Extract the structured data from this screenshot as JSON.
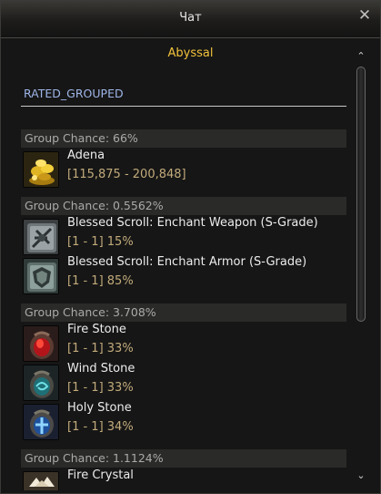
{
  "window": {
    "title": "Чат",
    "close_glyph": "✕"
  },
  "subtitle": "Abyssal",
  "section": {
    "label": "RATED_GROUPED"
  },
  "groups": [
    {
      "chance": "Group Chance: 66%",
      "items": [
        {
          "name": "Adena",
          "range": "[115,875 - 200,848]",
          "icon": "adena-icon"
        }
      ]
    },
    {
      "chance": "Group Chance: 0.5562%",
      "items": [
        {
          "name": "Blessed Scroll: Enchant Weapon (S-Grade)",
          "range": "[1 - 1] 15%",
          "icon": "scroll-weapon-icon"
        },
        {
          "name": "Blessed Scroll: Enchant Armor (S-Grade)",
          "range": "[1 - 1] 85%",
          "icon": "scroll-armor-icon"
        }
      ]
    },
    {
      "chance": "Group Chance: 3.708%",
      "items": [
        {
          "name": "Fire Stone",
          "range": "[1 - 1] 33%",
          "icon": "fire-stone-icon"
        },
        {
          "name": "Wind Stone",
          "range": "[1 - 1] 33%",
          "icon": "wind-stone-icon"
        },
        {
          "name": "Holy Stone",
          "range": "[1 - 1] 34%",
          "icon": "holy-stone-icon"
        }
      ]
    },
    {
      "chance": "Group Chance: 1.1124%",
      "items": [
        {
          "name": "Fire Crystal",
          "range": "",
          "icon": "fire-crystal-icon"
        }
      ]
    }
  ],
  "scrollbar": {
    "up_glyph": "⌃",
    "down_glyph": "⌄"
  },
  "colors": {
    "subtitle": "#f2c23a",
    "section_label": "#9fb6e8",
    "range_text": "#c2ab7b",
    "group_header_bg": "#2a2a28"
  }
}
